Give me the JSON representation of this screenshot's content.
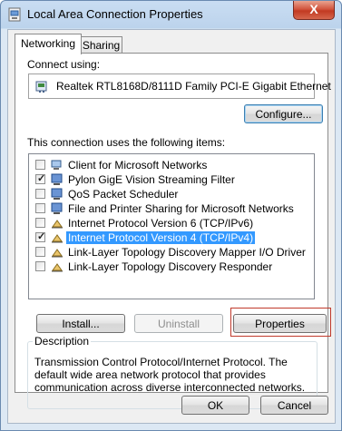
{
  "window": {
    "title": "Local Area Connection Properties",
    "close_label": "X"
  },
  "tabs": [
    {
      "label": "Networking"
    },
    {
      "label": "Sharing"
    }
  ],
  "connect_using_label": "Connect using:",
  "adapter_name": "Realtek RTL8168D/8111D Family PCI-E Gigabit Ethernet",
  "configure_label": "Configure...",
  "items_label": "This connection uses the following items:",
  "items": [
    {
      "label": "Client for Microsoft Networks",
      "checked": false,
      "icon": "network-client-icon"
    },
    {
      "label": "Pylon GigE Vision Streaming Filter",
      "checked": true,
      "icon": "network-filter-icon"
    },
    {
      "label": "QoS Packet Scheduler",
      "checked": false,
      "icon": "network-service-icon"
    },
    {
      "label": "File and Printer Sharing for Microsoft Networks",
      "checked": false,
      "icon": "network-service-icon"
    },
    {
      "label": "Internet Protocol Version 6 (TCP/IPv6)",
      "checked": false,
      "icon": "protocol-icon"
    },
    {
      "label": "Internet Protocol Version 4 (TCP/IPv4)",
      "checked": true,
      "icon": "protocol-icon",
      "selected": true
    },
    {
      "label": "Link-Layer Topology Discovery Mapper I/O Driver",
      "checked": false,
      "icon": "protocol-icon"
    },
    {
      "label": "Link-Layer Topology Discovery Responder",
      "checked": false,
      "icon": "protocol-icon"
    }
  ],
  "buttons": {
    "install": "Install...",
    "uninstall": "Uninstall",
    "properties": "Properties",
    "ok": "OK",
    "cancel": "Cancel"
  },
  "description": {
    "title": "Description",
    "text": "Transmission Control Protocol/Internet Protocol. The default wide area network protocol that provides communication across diverse interconnected networks."
  },
  "colors": {
    "selection": "#3399ff",
    "highlight_box": "#c0392b",
    "close_button": "#c23a22"
  }
}
